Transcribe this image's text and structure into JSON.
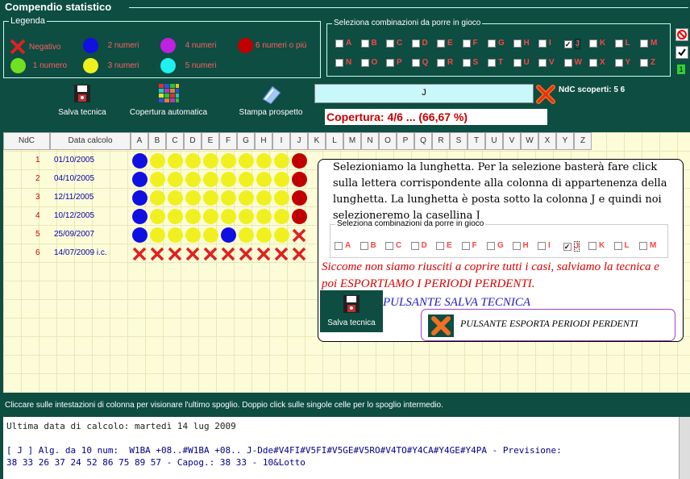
{
  "window": {
    "title": "Compendio statistico"
  },
  "legend": {
    "caption": "Legenda",
    "items": [
      {
        "label": "Negativo",
        "color": "#e02020",
        "kind": "x"
      },
      {
        "label": "2 numeri",
        "color": "#1010e0"
      },
      {
        "label": "4 numeri",
        "color": "#c020e0"
      },
      {
        "label": "6 numeri o più",
        "color": "#c00000"
      },
      {
        "label": "1 numero",
        "color": "#70e020"
      },
      {
        "label": "3 numeri",
        "color": "#f0f020"
      },
      {
        "label": "5 numeri",
        "color": "#20f0f0"
      }
    ]
  },
  "selector": {
    "caption": "Seleziona combinazioni da porre in gioco",
    "row1": [
      "A",
      "B",
      "C",
      "D",
      "E",
      "F",
      "G",
      "H",
      "I",
      "J",
      "K",
      "L",
      "M"
    ],
    "row2": [
      "N",
      "O",
      "P",
      "Q",
      "R",
      "S",
      "T",
      "U",
      "V",
      "W",
      "X",
      "Y",
      "Z"
    ],
    "checked": "J"
  },
  "toolbar": {
    "salva": "Salva tecnica",
    "copertura": "Copertura automatica",
    "stampa": "Stampa prospetto"
  },
  "selected_field": "J",
  "ndc_scoperti": "NdC scoperti: 5 6",
  "coverage": "Copertura: 4/6 ... (66,67 %)",
  "table": {
    "headers": [
      "NdC",
      "Data calcolo",
      "A",
      "B",
      "C",
      "D",
      "E",
      "F",
      "G",
      "H",
      "I",
      "J",
      "K",
      "L",
      "M",
      "N",
      "O",
      "P",
      "Q",
      "R",
      "S",
      "T",
      "U",
      "V",
      "W",
      "X",
      "Y",
      "Z"
    ],
    "rows": [
      {
        "n": "1",
        "date": "01/10/2005",
        "cells": [
          "b",
          "y",
          "y",
          "y",
          "y",
          "y",
          "y",
          "y",
          "y",
          "r"
        ]
      },
      {
        "n": "2",
        "date": "04/10/2005",
        "cells": [
          "b",
          "y",
          "y",
          "y",
          "y",
          "y",
          "y",
          "y",
          "y",
          "r"
        ]
      },
      {
        "n": "3",
        "date": "12/11/2005",
        "cells": [
          "b",
          "y",
          "y",
          "y",
          "y",
          "y",
          "y",
          "y",
          "y",
          "r"
        ]
      },
      {
        "n": "4",
        "date": "10/12/2005",
        "cells": [
          "b",
          "y",
          "y",
          "y",
          "y",
          "y",
          "y",
          "y",
          "y",
          "r"
        ]
      },
      {
        "n": "5",
        "date": "25/09/2007",
        "cells": [
          "b",
          "y",
          "y",
          "y",
          "y",
          "b",
          "y",
          "y",
          "y",
          "x"
        ]
      },
      {
        "n": "6",
        "date": "14/07/2009 i.c.",
        "cells": [
          "x",
          "x",
          "x",
          "x",
          "x",
          "x",
          "x",
          "x",
          "x",
          "x"
        ]
      }
    ]
  },
  "callout": {
    "text1": "Selezioniamo la lunghetta. Per la selezione basterà fare click sulla lettera corrispondente alla colonna di appartenenza della lunghetta. La lunghetta è posta sotto la colonna J e quindi noi selezioneremo la casellina J",
    "mini_caption": "Seleziona combinazioni da porre in gioco",
    "text2": "Siccome non siamo riusciti a coprire tutti i casi, salviamo la tecnica  e poi ESPORTIAMO I PERIODI PERDENTI.",
    "text3": "PULSANTE SALVA TECNICA",
    "salva_label": "Salva tecnica",
    "export_label": "PULSANTE ESPORTA PERIODI PERDENTI"
  },
  "hint": "Cliccare sulle intestazioni di colonna per visionare l'ultimo spoglio. Doppio click sulle singole celle per lo spoglio intermedio.",
  "output": {
    "line1": "Ultima data di calcolo: martedì 14 lug 2009",
    "line2": "[ J ] Alg. da 10 num:  W1BA +08..#W1BA +08.. J-Dde#V4FI#V5FI#V5GE#V5RO#V4TO#Y4CA#Y4GE#Y4PA - Previsione:",
    "line3": "38 33 26 37 24 52 86 75 89 57 - Capog.: 38 33 - 10&Lotto"
  }
}
